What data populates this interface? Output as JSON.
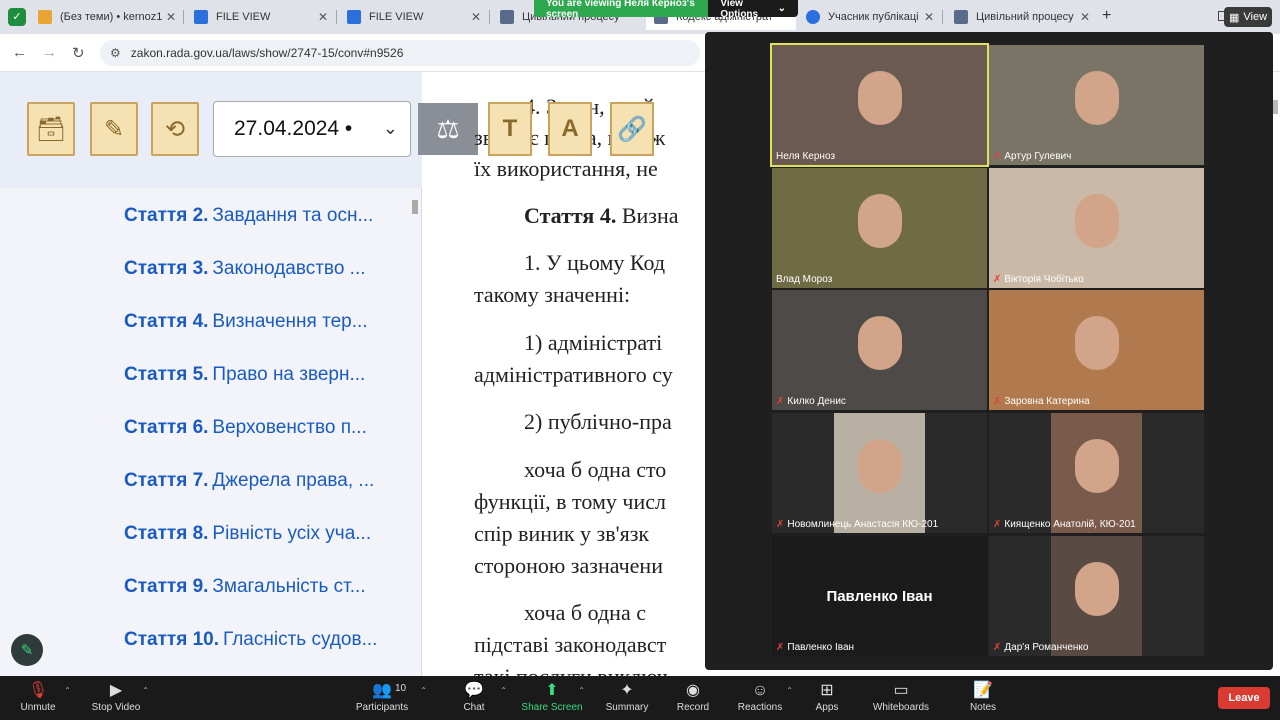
{
  "browser": {
    "tabs": [
      {
        "label": "(Без теми) • kernoz1",
        "fav_color": "#e8a534"
      },
      {
        "label": "FILE VIEW",
        "fav_color": "#2a6fdb"
      },
      {
        "label": "FILE VIEW",
        "fav_color": "#2a6fdb"
      },
      {
        "label": "Цивільний процесу",
        "fav_color": "#5a6a8a"
      },
      {
        "label": "Кодекс адміністрат",
        "fav_color": "#5a6a8a"
      },
      {
        "label": "Учасник публікаці",
        "fav_color": "#2a6fdb"
      },
      {
        "label": "Цивільний процесу",
        "fav_color": "#5a6a8a"
      }
    ],
    "url": "zakon.rada.gov.ua/laws/show/2747-15/conv#n9526"
  },
  "zoom_banner": {
    "viewing": "You are viewing Неля Кернoз's screen",
    "view_options": "View Options",
    "view_button": "View"
  },
  "page": {
    "date": "27.04.2024 •",
    "articles": [
      {
        "num": "Стаття 2.",
        "title": "Завдання та осн..."
      },
      {
        "num": "Стаття 3.",
        "title": "Законодавство ..."
      },
      {
        "num": "Стаття 4.",
        "title": "Визначення тер..."
      },
      {
        "num": "Стаття 5.",
        "title": "Право на зверн..."
      },
      {
        "num": "Стаття 6.",
        "title": "Верховенство п..."
      },
      {
        "num": "Стаття 7.",
        "title": "Джерела права, ..."
      },
      {
        "num": "Стаття 8.",
        "title": "Рівність усіх уча..."
      },
      {
        "num": "Стаття 9.",
        "title": "Змагальність ст..."
      },
      {
        "num": "Стаття 10.",
        "title": "Гласність судов..."
      }
    ],
    "doc_lines": [
      "4.  Закон,  який",
      "звужує права, належ",
      "їх використання, не",
      "Стаття 4. Визна",
      "1. У цьому Код",
      "такому значенні:",
      "1)   адміністраті",
      "адміністративного су",
      "2) публічно-пра",
      "хоча б одна сто",
      "функції, в тому числ",
      "спір  виник  у  зв'язк",
      "стороною зазначени",
      "хоча  б  одна  с",
      "підставі законодавст",
      "такі  послуги  виключ"
    ],
    "toolbar_letters": {
      "t": "T",
      "a": "A"
    }
  },
  "participants": [
    {
      "name": "Неля Кернoз",
      "muted": false,
      "speaker": true,
      "bg": "#6b5a52"
    },
    {
      "name": "Артур Гулевич",
      "muted": true,
      "speaker": false,
      "bg": "#7a7466"
    },
    {
      "name": "Влад Мороз",
      "muted": false,
      "speaker": false,
      "bg": "#6e6b45"
    },
    {
      "name": "Вікторія Чобітько",
      "muted": true,
      "speaker": false,
      "bg": "#c9b9a6"
    },
    {
      "name": "Килко Денис",
      "muted": true,
      "speaker": false,
      "bg": "#4d4a48"
    },
    {
      "name": "Заровна Катерина",
      "muted": true,
      "speaker": false,
      "bg": "#b07a4e"
    },
    {
      "name": "Новомлинець Анастасія КЮ-201",
      "muted": true,
      "speaker": false,
      "bg": "#b8b0a2"
    },
    {
      "name": "Киященко Анатолій, КЮ-201",
      "muted": true,
      "speaker": false,
      "bg": "#7a5a4a"
    },
    {
      "name": "Павленко Іван",
      "muted": true,
      "speaker": false,
      "bg": "#1b1b1b",
      "video_off": true,
      "big_name": "Павленко Іван"
    },
    {
      "name": "Дар'я Романченко",
      "muted": true,
      "speaker": false,
      "bg": "#5a4a44"
    }
  ],
  "zoom_bar": {
    "unmute": "Unmute",
    "stop_video": "Stop Video",
    "participants": "Participants",
    "participants_count": "10",
    "chat": "Chat",
    "share_screen": "Share Screen",
    "summary": "Summary",
    "record": "Record",
    "reactions": "Reactions",
    "apps": "Apps",
    "whiteboards": "Whiteboards",
    "notes": "Notes",
    "leave": "Leave"
  }
}
